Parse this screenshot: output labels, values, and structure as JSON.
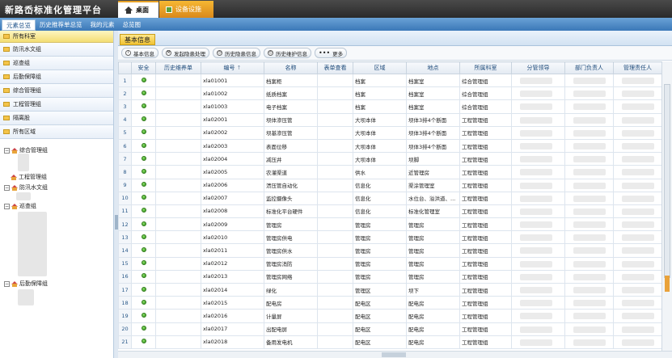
{
  "app": {
    "title": "新路岙标准化管理平台"
  },
  "top_tabs": [
    {
      "label": "桌面",
      "icon": "home-icon"
    },
    {
      "label": "设备设施",
      "icon": "equipment-icon"
    }
  ],
  "nav_tabs": [
    "元素总览",
    "历史推荐单总览",
    "我的元素",
    "总览图"
  ],
  "left_panel": {
    "items": [
      "所有科室",
      "防汛水文组",
      "巡查组",
      "后勤保障组",
      "综合管理组",
      "工程管理组",
      "隔离股",
      "所有区域"
    ],
    "tree": [
      {
        "label": "综合管理组",
        "expanded": true
      },
      {
        "label": "工程管理组",
        "expanded": false
      },
      {
        "label": "防汛水文组",
        "expanded": true
      },
      {
        "label": "巡查组",
        "expanded": true
      },
      {
        "label": "后勤保障组",
        "expanded": true
      }
    ]
  },
  "main": {
    "section_title": "基本信息",
    "toolbar": [
      "基本信息",
      "发起隐患处理",
      "历史隐患信息",
      "历史维护信息",
      "更多"
    ],
    "columns": [
      "",
      "安全",
      "历史维养单",
      "编号",
      "名称",
      "表单查看",
      "区域",
      "地点",
      "所属科室",
      "分管领导",
      "部门负责人",
      "管理责任人"
    ],
    "sort_mark": "↑",
    "rows": [
      {
        "n": "1",
        "code": "xla01001",
        "name": "档案柜",
        "area": "档案",
        "place": "档案室",
        "dept": "综合管理组"
      },
      {
        "n": "2",
        "code": "xla01002",
        "name": "纸质档案",
        "area": "档案",
        "place": "档案室",
        "dept": "综合管理组"
      },
      {
        "n": "3",
        "code": "xla01003",
        "name": "电子档案",
        "area": "档案",
        "place": "档案室",
        "dept": "综合管理组"
      },
      {
        "n": "4",
        "code": "xla02001",
        "name": "坝体渗压管",
        "area": "大坝本体",
        "place": "坝体3排4个断面",
        "dept": "工程管理组"
      },
      {
        "n": "5",
        "code": "xla02002",
        "name": "坝基渗压管",
        "area": "大坝本体",
        "place": "坝体3排4个断面",
        "dept": "工程管理组"
      },
      {
        "n": "6",
        "code": "xla02003",
        "name": "表面位移",
        "area": "大坝本体",
        "place": "坝体3排4个断面",
        "dept": "工程管理组"
      },
      {
        "n": "7",
        "code": "xla02004",
        "name": "减压井",
        "area": "大坝本体",
        "place": "坝脚",
        "dept": "工程管理组"
      },
      {
        "n": "8",
        "code": "xla02005",
        "name": "农灌渠道",
        "area": "供水",
        "place": "近管理房",
        "dept": "工程管理组"
      },
      {
        "n": "9",
        "code": "xla02006",
        "name": "溃压管自动化",
        "area": "信息化",
        "place": "渠涂管理室",
        "dept": "工程管理组"
      },
      {
        "n": "10",
        "code": "xla02007",
        "name": "监控摄像头",
        "area": "信息化",
        "place": "水位台、溢洪道、...",
        "dept": "工程管理组"
      },
      {
        "n": "11",
        "code": "xla02008",
        "name": "标准化平台硬件",
        "area": "信息化",
        "place": "标准化管理室",
        "dept": "工程管理组"
      },
      {
        "n": "12",
        "code": "xla02009",
        "name": "管理房",
        "area": "管理房",
        "place": "管理房",
        "dept": "工程管理组"
      },
      {
        "n": "13",
        "code": "xla02010",
        "name": "管理房供电",
        "area": "管理房",
        "place": "管理房",
        "dept": "工程管理组"
      },
      {
        "n": "14",
        "code": "xla02011",
        "name": "管理房供水",
        "area": "管理房",
        "place": "管理房",
        "dept": "工程管理组"
      },
      {
        "n": "15",
        "code": "xla02012",
        "name": "管理房消防",
        "area": "管理房",
        "place": "管理房",
        "dept": "工程管理组"
      },
      {
        "n": "16",
        "code": "xla02013",
        "name": "管理房网络",
        "area": "管理房",
        "place": "管理房",
        "dept": "工程管理组"
      },
      {
        "n": "17",
        "code": "xla02014",
        "name": "绿化",
        "area": "管理区",
        "place": "坝下",
        "dept": "工程管理组"
      },
      {
        "n": "18",
        "code": "xla02015",
        "name": "配电房",
        "area": "配电区",
        "place": "配电房",
        "dept": "工程管理组"
      },
      {
        "n": "19",
        "code": "xla02016",
        "name": "计量屏",
        "area": "配电区",
        "place": "配电房",
        "dept": "工程管理组"
      },
      {
        "n": "20",
        "code": "xla02017",
        "name": "出配电屏",
        "area": "配电区",
        "place": "配电房",
        "dept": "工程管理组"
      },
      {
        "n": "21",
        "code": "xla02018",
        "name": "备用发电机",
        "area": "配电区",
        "place": "配电房",
        "dept": "工程管理组"
      }
    ]
  },
  "colors": {
    "accent_orange": "#e7a227",
    "nav_blue": "#3b78b8",
    "header_text": "#1d4a7a",
    "ok_green": "#2f8f1c"
  },
  "chart_data": {
    "type": "table",
    "columns": [
      "安全",
      "历史维养单",
      "编号",
      "名称",
      "表单查看",
      "区域",
      "地点",
      "所属科室",
      "分管领导",
      "部门负责人",
      "管理责任人"
    ],
    "row_count_visible": 21
  }
}
